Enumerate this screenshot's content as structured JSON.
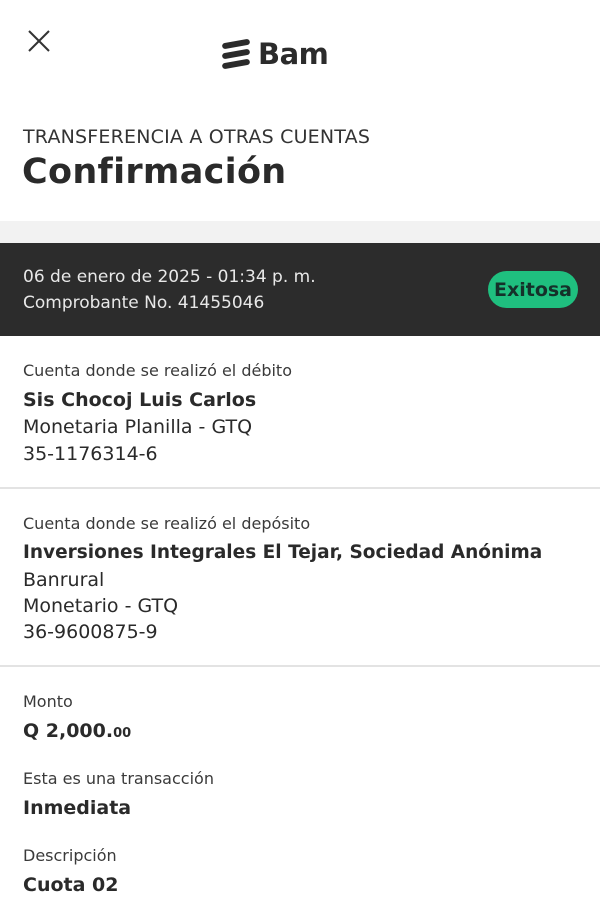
{
  "header": {
    "close_icon": "close-icon",
    "brand_name": "Bam"
  },
  "page": {
    "subtitle": "TRANSFERENCIA A OTRAS CUENTAS",
    "title": "Confirmación"
  },
  "status": {
    "date": "06 de enero de 2025 - 01:34 p. m.",
    "receipt": "Comprobante No. 41455046",
    "badge": "Exitosa",
    "badge_color": "#1fbf7f",
    "bar_color": "#2c2c2c"
  },
  "debit": {
    "label": "Cuenta donde se realizó el débito",
    "holder": "Sis Chocoj Luis Carlos",
    "account_type": "Monetaria Planilla - GTQ",
    "account_number": "35-1176314-6"
  },
  "deposit": {
    "label": "Cuenta donde se realizó el depósito",
    "holder": "Inversiones Integrales El Tejar, Sociedad Anónima",
    "bank": "Banrural",
    "account_type": "Monetario - GTQ",
    "account_number": "36-9600875-9"
  },
  "details": {
    "amount_label": "Monto",
    "amount_main": "Q 2,000.",
    "amount_cents": "00",
    "transaction_label": "Esta es una transacción",
    "transaction_value": "Inmediata",
    "description_label": "Descripción",
    "description_value": "Cuota 02"
  }
}
